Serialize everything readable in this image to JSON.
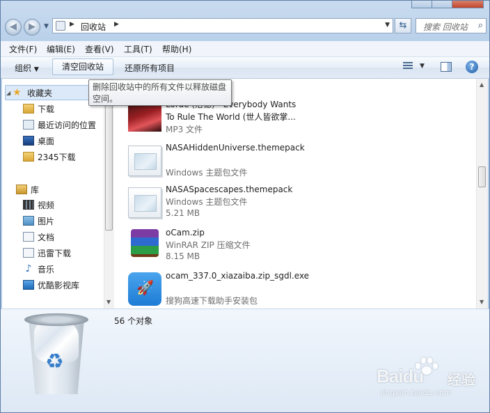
{
  "address": {
    "location": "回收站",
    "search_placeholder": "搜索 回收站"
  },
  "menu": [
    "文件(F)",
    "编辑(E)",
    "查看(V)",
    "工具(T)",
    "帮助(H)"
  ],
  "commands": {
    "organize": "组织",
    "empty_bin": "清空回收站",
    "restore_all": "还原所有项目"
  },
  "tooltip": "删除回收站中的所有文件以释放磁盘空间。",
  "nav": {
    "favorites_label": "收藏夹",
    "favorites": [
      "下载",
      "最近访问的位置",
      "桌面",
      "2345下载"
    ],
    "libraries_label": "库",
    "libraries": [
      "视频",
      "图片",
      "文档",
      "迅雷下载",
      "音乐",
      "优酷影视库"
    ]
  },
  "files": [
    {
      "name": "Lorde (洛德) - Everybody Wants To Rule The World (世人皆欲掌...",
      "type": "MP3 文件",
      "size": ""
    },
    {
      "name": "NASAHiddenUniverse.themepack",
      "type": "Windows 主题包文件",
      "size": ""
    },
    {
      "name": "NASASpacescapes.themepack",
      "type": "Windows 主题包文件",
      "size": "5.21 MB"
    },
    {
      "name": "oCam.zip",
      "type": "WinRAR ZIP 压缩文件",
      "size": "8.15 MB"
    },
    {
      "name": "ocam_337.0_xiazaiba.zip_sgdl.exe",
      "type": "搜狗高速下载助手安装包",
      "size": ""
    }
  ],
  "details": {
    "count": "56 个对象"
  },
  "watermark": {
    "brand": "Baidu",
    "suffix": "经验",
    "url": "jingyan.baidu.com"
  }
}
